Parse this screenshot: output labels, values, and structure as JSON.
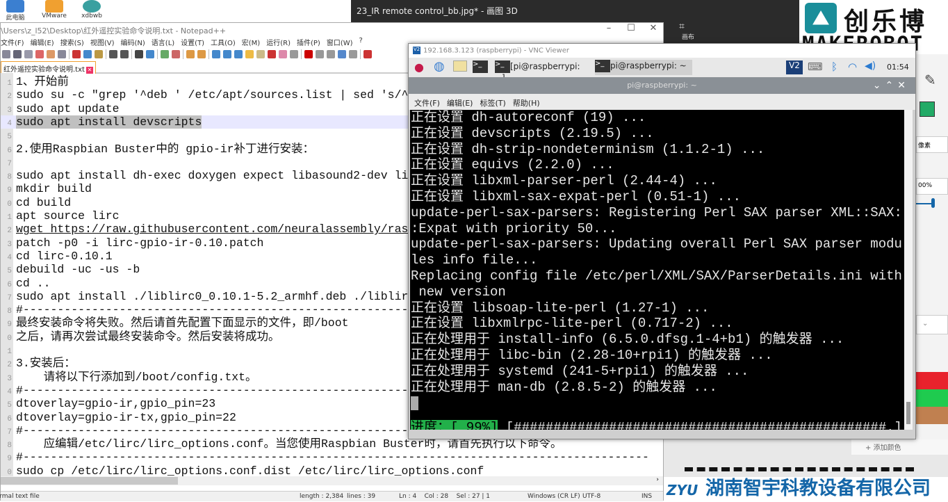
{
  "desktop": {
    "icons": [
      {
        "label": "此电脑",
        "color": "#3b7fd0"
      },
      {
        "label": "VMware",
        "color": "#f0a030"
      },
      {
        "label": "xdbwb",
        "color": "#3aa0a0"
      }
    ]
  },
  "paint3d": {
    "title": "23_IR remote control_bb.jpg* - 画图 3D",
    "tool_label": "画布",
    "side_labels": {
      "pixels": "像素",
      "percent": "00%"
    },
    "swatches": [
      "#e8222c",
      "#1fcb4f",
      "#c08050"
    ],
    "add_color": "+ 添加颜色"
  },
  "logo": {
    "mark": "⌂",
    "cn": "创乐博",
    "en": "MAKEROBOT"
  },
  "banner": {
    "mark": "ZYU",
    "text": "湖南智宇科教设备有限公司"
  },
  "notepad": {
    "title": "\\Users\\z_l52\\Desktop\\红外遥控实验命令说明.txt - Notepad++",
    "menu": [
      "文件(F)",
      "编辑(E)",
      "搜索(S)",
      "视图(V)",
      "编码(N)",
      "语言(L)",
      "设置(T)",
      "工具(O)",
      "宏(M)",
      "运行(R)",
      "插件(P)",
      "窗口(W)",
      "?"
    ],
    "tab": "红外遥控实验命令说明.txt",
    "current_line": 4,
    "lines": [
      "1、开始前",
      "sudo su -c \"grep '^deb ' /etc/apt/sources.list | sed 's/^",
      "sudo apt update",
      "sudo apt install devscripts",
      "",
      "2.使用Raspbian Buster中的 gpio-ir补丁进行安装：",
      "",
      "sudo apt install dh-exec doxygen expect libasound2-dev li",
      "mkdir build",
      "cd build",
      "apt source lirc",
      "wget https://raw.githubusercontent.com/neuralassembly/ras",
      "patch -p0 -i lirc-gpio-ir-0.10.patch",
      "cd lirc-0.10.1",
      "debuild -uc -us -b",
      "cd ..",
      "sudo apt install ./liblirc0_0.10.1-5.2_armhf.deb ./liblir",
      "#-------------------------------------------------------------------------------------------",
      "最终安装命令将失败。然后请首先配置下面显示的文件，即/boot",
      "之后，请再次尝试最终安装命令。然后安装将成功。",
      "",
      "3.安装后：",
      "    请将以下行添加到/boot/config.txt。",
      "#-------------------------------------------------------------------------------------------",
      "dtoverlay=gpio-ir,gpio_pin=23",
      "dtoverlay=gpio-ir-tx,gpio_pin=22",
      "#-------------------------------------------------------------------------------------------",
      "    应编辑/etc/lirc/lirc_options.conf。当您使用Raspbian Buster时，请首先执行以下命令。",
      "#-------------------------------------------------------------------------------------------",
      "sudo cp /etc/lirc/lirc_options.conf.dist /etc/lirc/lirc_options.conf"
    ],
    "status": {
      "type": "Normal text file",
      "length": "length : 2,384",
      "lines": "lines : 39",
      "pos": "Ln : 4    Col : 28    Sel : 27 | 1",
      "eol": "Windows (CR LF)",
      "enc": "UTF-8",
      "mode": "INS"
    }
  },
  "vnc": {
    "title": "192.168.3.123 (raspberrypi) - VNC Viewer",
    "taskbar": {
      "task1": "[pi@raspberrypi: ~]",
      "task2": "pi@raspberrypi: ~",
      "clock": "01:54"
    },
    "terminal": {
      "title": "pi@raspberrypi: ~",
      "menu": [
        "文件(F)",
        "编辑(E)",
        "标签(T)",
        "帮助(H)"
      ],
      "lines": [
        "正在设置 dh-autoreconf (19) ...",
        "正在设置 devscripts (2.19.5) ...",
        "正在设置 dh-strip-nondeterminism (1.1.2-1) ...",
        "正在设置 equivs (2.2.0) ...",
        "正在设置 libxml-parser-perl (2.44-4) ...",
        "正在设置 libxml-sax-expat-perl (0.51-1) ...",
        "update-perl-sax-parsers: Registering Perl SAX parser XML::SAX:",
        ":Expat with priority 50...",
        "update-perl-sax-parsers: Updating overall Perl SAX parser modu",
        "les info file...",
        "Replacing config file /etc/perl/XML/SAX/ParserDetails.ini with",
        " new version",
        "正在设置 libsoap-lite-perl (1.27-1) ...",
        "正在设置 libxmlrpc-lite-perl (0.717-2) ...",
        "正在处理用于 install-info (6.5.0.dfsg.1-4+b1) 的触发器 ...",
        "正在处理用于 libc-bin (2.28-10+rpi1) 的触发器 ...",
        "正在处理用于 systemd (241-5+rpi1) 的触发器 ...",
        "正在处理用于 man-db (2.8.5-2) 的触发器 ..."
      ],
      "progress_label": "进度：[ 99%]",
      "progress_percent": 99,
      "progress_bar": " [###############################################.]"
    }
  }
}
